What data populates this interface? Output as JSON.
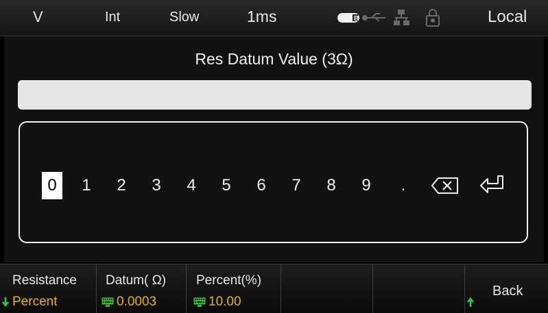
{
  "status_bar": {
    "mode": "V",
    "integration": "Int",
    "speed": "Slow",
    "interval": "1ms",
    "remote": "Local",
    "icons": [
      "battery-icon",
      "usb-icon",
      "network-icon",
      "lock-icon"
    ]
  },
  "dialog": {
    "title": "Res Datum Value (3Ω)",
    "input_value": "",
    "keys": [
      "0",
      "1",
      "2",
      "3",
      "4",
      "5",
      "6",
      "7",
      "8",
      "9",
      "."
    ],
    "selected_key": "0",
    "backspace_icon": "backspace-icon",
    "enter_icon": "enter-icon"
  },
  "softkeys": [
    {
      "label": "Resistance",
      "value": "Percent",
      "value_icon": "arrow-down-icon"
    },
    {
      "label": "Datum( Ω)",
      "value": "0.0003",
      "value_icon": "keypad-icon"
    },
    {
      "label": "Percent(%)",
      "value": "10.00",
      "value_icon": "keypad-icon"
    },
    {
      "label": "",
      "value": ""
    },
    {
      "label": "",
      "value": ""
    },
    {
      "label": "Back",
      "value_icon": "arrow-up-icon"
    }
  ],
  "colors": {
    "value_text": "#e6b400",
    "keypad_icon": "#3cb43c",
    "arrow_icon": "#2ecc40"
  }
}
